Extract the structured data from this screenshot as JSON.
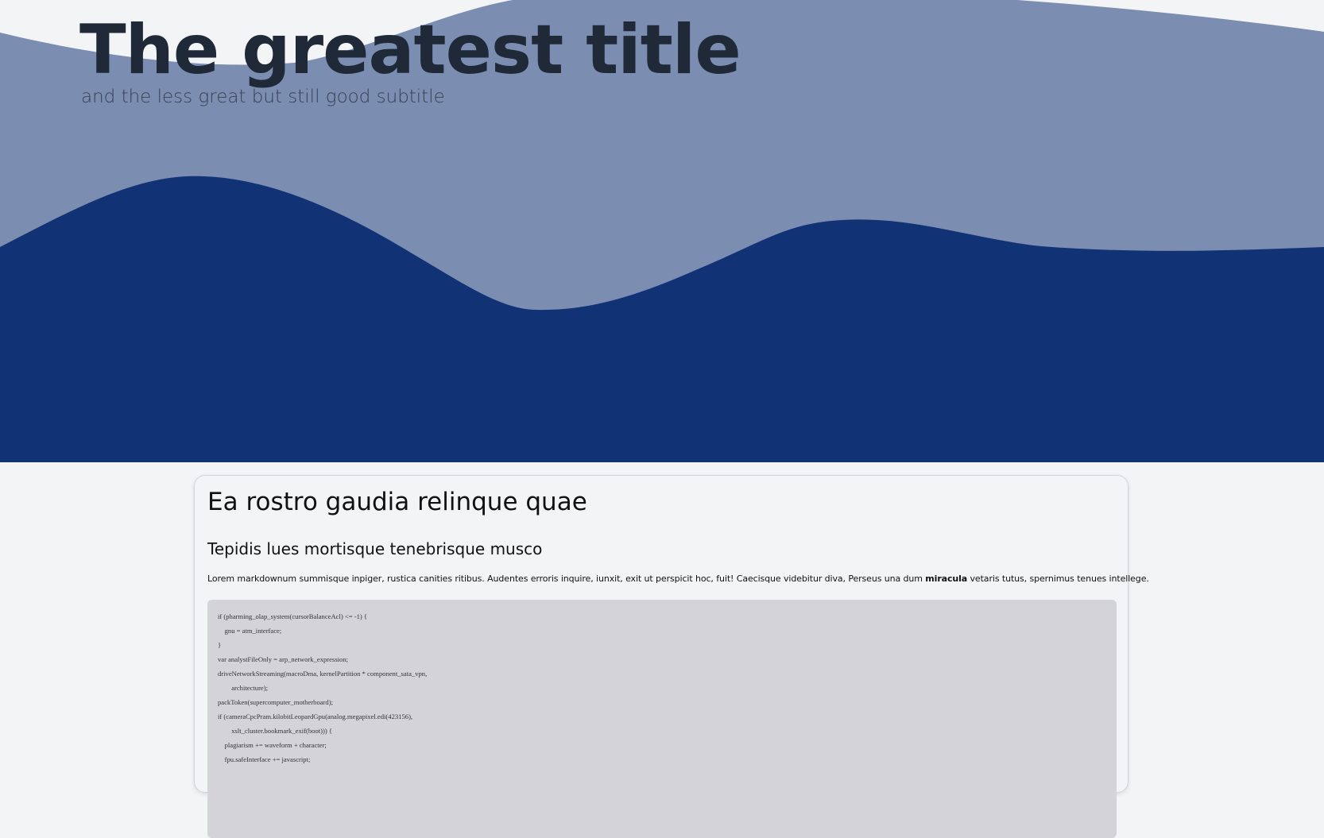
{
  "hero": {
    "title": "The greatest title",
    "subtitle": "and the less great but still good subtitle",
    "colors": {
      "background": "#f3f4f6",
      "light_wave": "#7c8db2",
      "dark_wave": "#113275",
      "title": "#1f2937"
    }
  },
  "article": {
    "heading": "Ea rostro gaudia relinque quae",
    "subheading": "Tepidis lues mortisque tenebrisque musco",
    "paragraph": {
      "before": "Lorem markdownum summisque inpiger, rustica canities ritibus. Audentes erroris inquire, iunxit, exit ut perspicit hoc, fuit! Caecisque videbitur diva, Perseus una dum ",
      "bold": "miracula",
      "after": " vetaris tutus, spernimus tenues intellege."
    },
    "code_lines": [
      "if (pharming_olap_system(cursorBalanceAcl) <= -1) {",
      "    gnu = atm_interface;",
      "}",
      "var analystFileOnly = arp_network_expression;",
      "driveNetworkStreaming(macroDma, kernelPartition * component_sata_vpn,",
      "        architecture);",
      "packToken(supercomputer_motherboard);",
      "if (cameraCpcPram.kilobitLeopardGpu(analog.megapixel.edi(423156),",
      "        xslt_cluster.bookmark_exif(boot))) {",
      "    plagiarism += waveform + character;",
      "    fpu.safeInterface += javascript;"
    ]
  }
}
